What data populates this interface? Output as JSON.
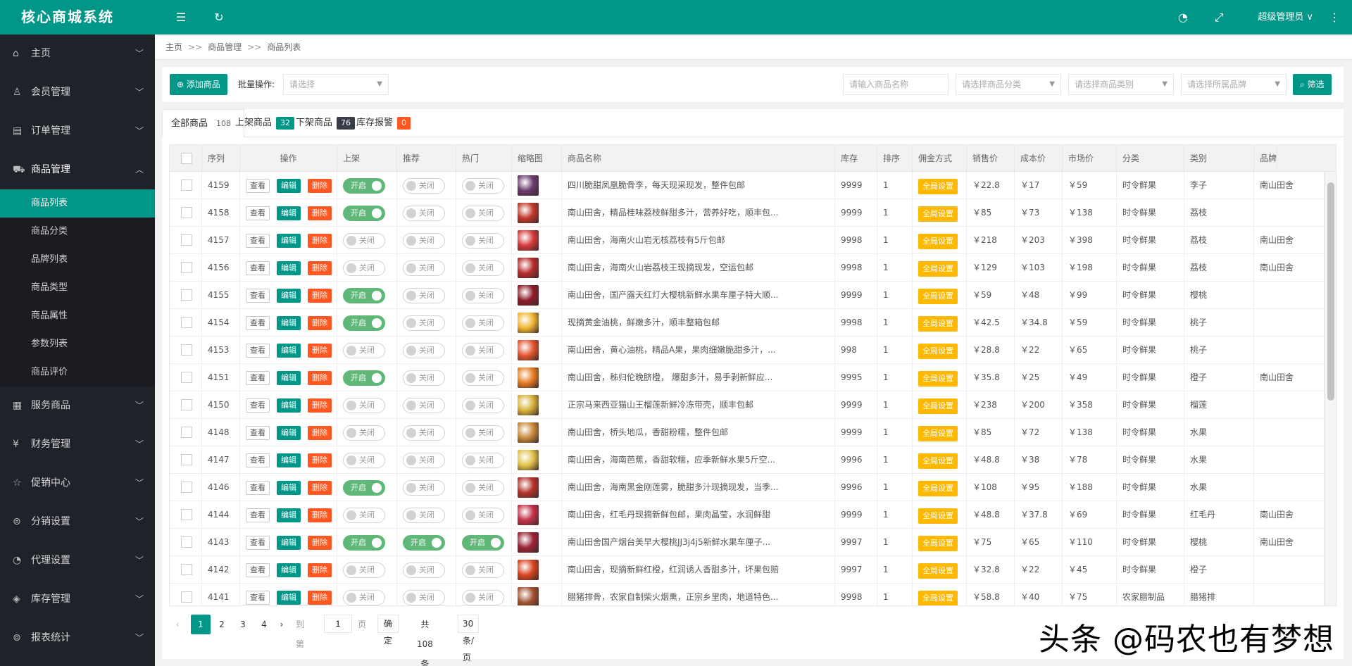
{
  "app": {
    "title": "核心商城系统",
    "admin_name": "超级管理员 ∨"
  },
  "topbar_icons": [
    "menu-fold-icon",
    "refresh-icon",
    "theme-icon",
    "fullscreen-icon",
    "more-icon"
  ],
  "sidebar": {
    "groups": [
      {
        "label": "主页",
        "icon": "⌂",
        "open": false
      },
      {
        "label": "会员管理",
        "icon": "♙",
        "open": false
      },
      {
        "label": "订单管理",
        "icon": "▤",
        "open": false
      },
      {
        "label": "商品管理",
        "icon": "⛟",
        "open": true
      },
      {
        "label": "服务商品",
        "icon": "▦",
        "open": false
      },
      {
        "label": "财务管理",
        "icon": "¥",
        "open": false
      },
      {
        "label": "促销中心",
        "icon": "☆",
        "open": false
      },
      {
        "label": "分销设置",
        "icon": "⊜",
        "open": false
      },
      {
        "label": "代理设置",
        "icon": "◔",
        "open": false
      },
      {
        "label": "库存管理",
        "icon": "◈",
        "open": false
      },
      {
        "label": "报表统计",
        "icon": "⊚",
        "open": false
      }
    ],
    "sub_items": [
      "商品列表",
      "商品分类",
      "品牌列表",
      "商品类型",
      "商品属性",
      "参数列表",
      "商品评价"
    ],
    "active_sub": "商品列表"
  },
  "breadcrumb": [
    "主页",
    "商品管理",
    "商品列表"
  ],
  "breadcrumb_sep": ">>",
  "toolbar": {
    "add_label": "添加商品",
    "batch_label": "批量操作:",
    "batch_placeholder": "请选择",
    "name_placeholder": "请输入商品名称",
    "category_placeholder": "请选择商品分类",
    "type_placeholder": "请选择商品类别",
    "brand_placeholder": "请选择所属品牌",
    "filter_label": "筛选"
  },
  "tabs": [
    {
      "label": "全部商品",
      "count": "108",
      "style": "plain"
    },
    {
      "label": "上架商品",
      "count": "32",
      "style": "green"
    },
    {
      "label": "下架商品",
      "count": "76",
      "style": "dark"
    },
    {
      "label": "库存报警",
      "count": "0",
      "style": "orange"
    }
  ],
  "table": {
    "headers": [
      "序列",
      "操作",
      "上架",
      "推荐",
      "热门",
      "缩略图",
      "商品名称",
      "库存",
      "排序",
      "佣金方式",
      "销售价",
      "成本价",
      "市场价",
      "分类",
      "类别",
      "品牌"
    ],
    "action_labels": {
      "view": "查看",
      "edit": "编辑",
      "delete": "删除"
    },
    "switch_on": "开启",
    "switch_off": "关闭",
    "commission_label": "全局设置",
    "rows": [
      {
        "id": "4159",
        "up": true,
        "rec": false,
        "hot": false,
        "color": "#6b3a6e",
        "name": "四川脆甜凤凰脆骨李，每天现采现发，整件包邮",
        "stock": "9999",
        "sort": "1",
        "price": "￥22.8",
        "cost": "￥17",
        "market": "￥59",
        "cat": "时令鲜果",
        "kind": "李子",
        "brand": "南山田舍"
      },
      {
        "id": "4158",
        "up": true,
        "rec": false,
        "hot": false,
        "color": "#c0392b",
        "name": "南山田舍，精品桂味荔枝鲜甜多汁，营养好吃，顺丰包...",
        "stock": "9999",
        "sort": "1",
        "price": "￥85",
        "cost": "￥73",
        "market": "￥138",
        "cat": "时令鲜果",
        "kind": "荔枝",
        "brand": ""
      },
      {
        "id": "4157",
        "up": false,
        "rec": false,
        "hot": false,
        "color": "#d63a3a",
        "name": "南山田舍，海南火山岩无核荔枝有5斤包邮",
        "stock": "9998",
        "sort": "1",
        "price": "￥218",
        "cost": "￥203",
        "market": "￥398",
        "cat": "时令鲜果",
        "kind": "荔枝",
        "brand": "南山田舍"
      },
      {
        "id": "4156",
        "up": false,
        "rec": false,
        "hot": false,
        "color": "#b82c2c",
        "name": "南山田舍，海南火山岩荔枝王现摘现发，空运包邮",
        "stock": "9998",
        "sort": "1",
        "price": "￥129",
        "cost": "￥103",
        "market": "￥198",
        "cat": "时令鲜果",
        "kind": "荔枝",
        "brand": "南山田舍"
      },
      {
        "id": "4155",
        "up": true,
        "rec": false,
        "hot": false,
        "color": "#8e1b2a",
        "name": "南山田舍，国产露天红灯大樱桃新鲜水果车厘子特大顺...",
        "stock": "9999",
        "sort": "1",
        "price": "￥59",
        "cost": "￥48",
        "market": "￥99",
        "cat": "时令鲜果",
        "kind": "樱桃",
        "brand": ""
      },
      {
        "id": "4154",
        "up": true,
        "rec": false,
        "hot": false,
        "color": "#f2b632",
        "name": "现摘黄金油桃，鲜嫩多汁，顺丰整箱包邮",
        "stock": "9998",
        "sort": "1",
        "price": "￥42.5",
        "cost": "￥34.8",
        "market": "￥59",
        "cat": "时令鲜果",
        "kind": "桃子",
        "brand": ""
      },
      {
        "id": "4153",
        "up": false,
        "rec": false,
        "hot": false,
        "color": "#e4572e",
        "name": "南山田舍，黄心油桃，精品A果，果肉细嫩脆甜多汁，...",
        "stock": "998",
        "sort": "1",
        "price": "￥28.8",
        "cost": "￥22",
        "market": "￥65",
        "cat": "时令鲜果",
        "kind": "桃子",
        "brand": ""
      },
      {
        "id": "4151",
        "up": true,
        "rec": false,
        "hot": false,
        "color": "#e67e22",
        "name": "南山田舍，秭归伦晚脐橙， 爆甜多汁，易手剥新鲜应...",
        "stock": "9995",
        "sort": "1",
        "price": "￥35.8",
        "cost": "￥25",
        "market": "￥49",
        "cat": "时令鲜果",
        "kind": "橙子",
        "brand": "南山田舍"
      },
      {
        "id": "4150",
        "up": false,
        "rec": false,
        "hot": false,
        "color": "#d9b23a",
        "name": "正宗马来西亚猫山王榴莲新鲜冷冻带壳，顺丰包邮",
        "stock": "9999",
        "sort": "1",
        "price": "￥238",
        "cost": "￥200",
        "market": "￥358",
        "cat": "时令鲜果",
        "kind": "榴莲",
        "brand": ""
      },
      {
        "id": "4148",
        "up": false,
        "rec": false,
        "hot": false,
        "color": "#c98a3c",
        "name": "南山田舍，桥头地瓜，香甜粉糯，整件包邮",
        "stock": "9999",
        "sort": "1",
        "price": "￥85",
        "cost": "￥72",
        "market": "￥138",
        "cat": "时令鲜果",
        "kind": "水果",
        "brand": ""
      },
      {
        "id": "4147",
        "up": false,
        "rec": false,
        "hot": false,
        "color": "#e3c24a",
        "name": "南山田舍，海南芭蕉，香甜软糯，应季新鲜水果5斤空...",
        "stock": "9996",
        "sort": "1",
        "price": "￥48.8",
        "cost": "￥38",
        "market": "￥78",
        "cat": "时令鲜果",
        "kind": "水果",
        "brand": ""
      },
      {
        "id": "4146",
        "up": true,
        "rec": false,
        "hot": false,
        "color": "#b5342a",
        "name": "南山田舍，海南黑金刚莲雾，脆甜多汁现摘现发，当季...",
        "stock": "9996",
        "sort": "1",
        "price": "￥108",
        "cost": "￥95",
        "market": "￥188",
        "cat": "时令鲜果",
        "kind": "水果",
        "brand": ""
      },
      {
        "id": "4144",
        "up": false,
        "rec": false,
        "hot": false,
        "color": "#c4304a",
        "name": "南山田舍，红毛丹现摘新鲜包邮，果肉晶莹，水润鲜甜",
        "stock": "9999",
        "sort": "1",
        "price": "￥48.8",
        "cost": "￥37.8",
        "market": "￥69",
        "cat": "时令鲜果",
        "kind": "红毛丹",
        "brand": "南山田舍"
      },
      {
        "id": "4143",
        "up": true,
        "rec": true,
        "hot": true,
        "color": "#9b2335",
        "name": "南山田舍国产烟台美早大樱桃JJ3j4j5新鲜水果车厘子...",
        "stock": "9997",
        "sort": "1",
        "price": "￥75",
        "cost": "￥65",
        "market": "￥110",
        "cat": "时令鲜果",
        "kind": "樱桃",
        "brand": "南山田舍"
      },
      {
        "id": "4142",
        "up": false,
        "rec": false,
        "hot": false,
        "color": "#d9441f",
        "name": "南山田舍，现摘新鲜红橙，红润诱人香甜多汁，坏果包赔",
        "stock": "9997",
        "sort": "1",
        "price": "￥32.8",
        "cost": "￥22",
        "market": "￥45",
        "cat": "时令鲜果",
        "kind": "橙子",
        "brand": ""
      },
      {
        "id": "4141",
        "up": false,
        "rec": false,
        "hot": false,
        "color": "#a0522d",
        "name": "腊猪排骨，农家自制柴火烟熏，正宗乡里肉，地道特色...",
        "stock": "9998",
        "sort": "1",
        "price": "￥58.8",
        "cost": "￥40",
        "market": "￥75",
        "cat": "农家腊制品",
        "kind": "腊猪排",
        "brand": ""
      }
    ]
  },
  "pager": {
    "pages": [
      "1",
      "2",
      "3",
      "4"
    ],
    "current": "1",
    "prev": "‹",
    "next": "›",
    "goto_label": "到第",
    "goto_value": "1",
    "page_unit": "页",
    "confirm": "确定",
    "total": "共 108 条",
    "page_size": "30 条/页"
  },
  "watermark": "头条 @码农也有梦想"
}
